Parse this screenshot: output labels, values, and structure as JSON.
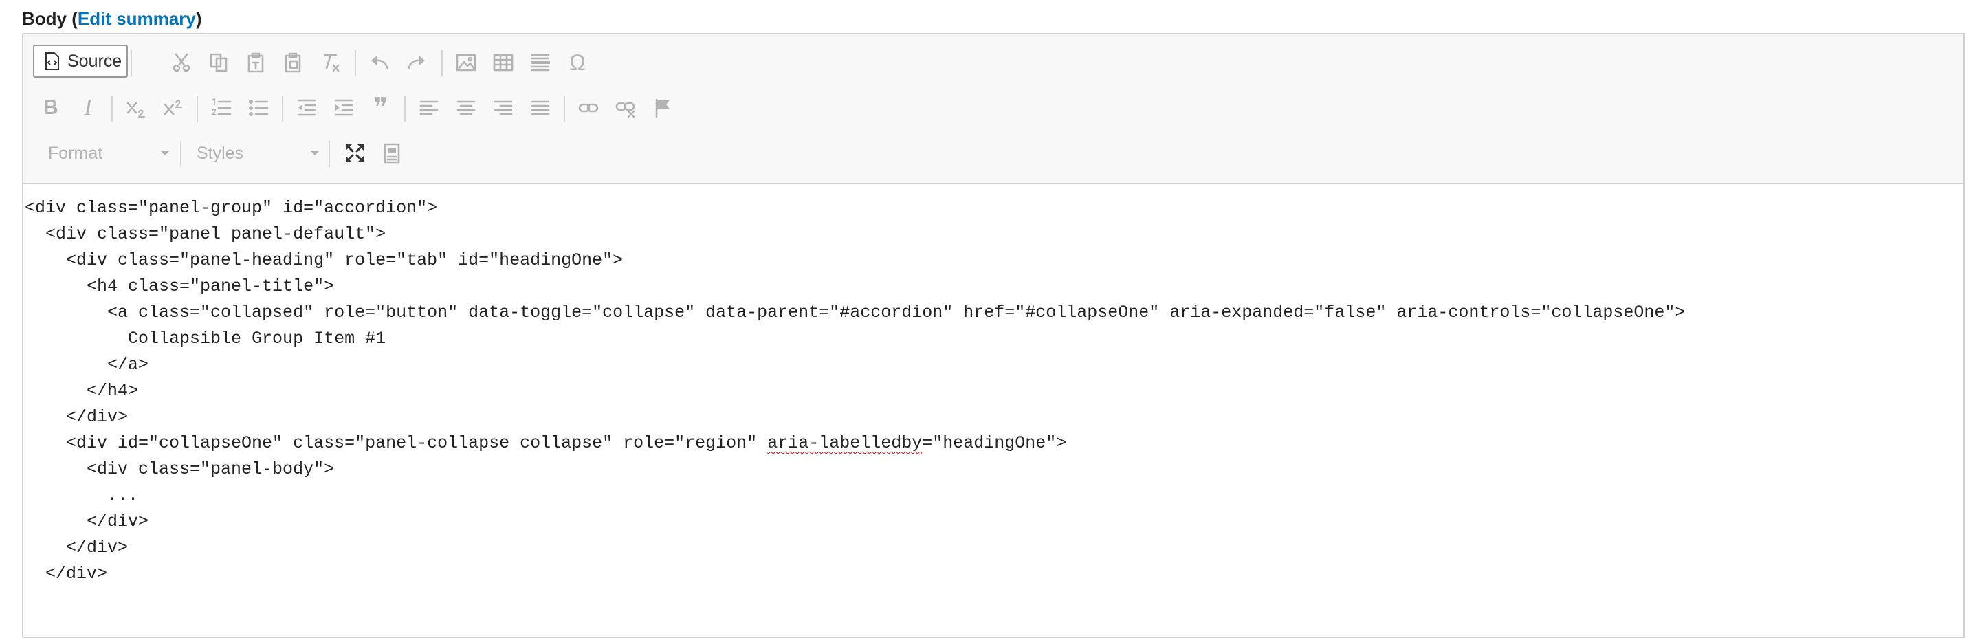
{
  "field": {
    "label": "Body",
    "open_paren": " (",
    "link": "Edit summary",
    "close_paren": ")"
  },
  "toolbar": {
    "source_label": "Source",
    "format_label": "Format",
    "styles_label": "Styles",
    "special_char_glyph": "Ω",
    "bold_glyph": "B",
    "italic_glyph": "I",
    "quote_glyph": "❞"
  },
  "code": {
    "lines": [
      "<div class=\"panel-group\" id=\"accordion\">",
      "  <div class=\"panel panel-default\">",
      "    <div class=\"panel-heading\" role=\"tab\" id=\"headingOne\">",
      "      <h4 class=\"panel-title\">",
      "        <a class=\"collapsed\" role=\"button\" data-toggle=\"collapse\" data-parent=\"#accordion\" href=\"#collapseOne\" aria-expanded=\"false\" aria-controls=\"collapseOne\">",
      "          Collapsible Group Item #1",
      "        </a>",
      "      </h4>",
      "    </div>",
      "    ",
      "      <div class=\"panel-body\">",
      "        ...",
      "      </div>",
      "    </div>",
      "  </div>"
    ],
    "line9_before": "    <div id=\"collapseOne\" class=\"panel-collapse collapse\" role=\"region\" ",
    "line9_misspelled": "aria-labelledby",
    "line9_after": "=\"headingOne\">"
  }
}
